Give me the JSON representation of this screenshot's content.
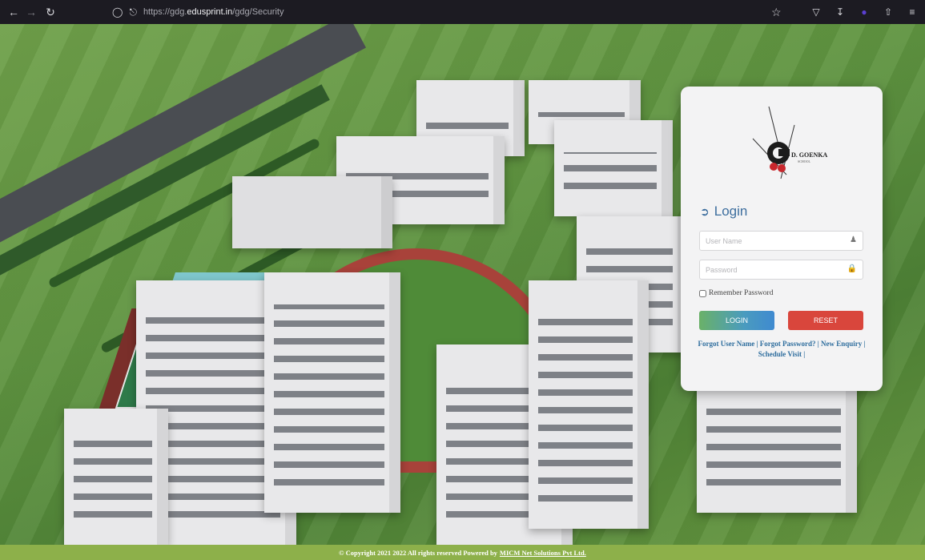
{
  "browser": {
    "url_prefix": "https://gdg.",
    "url_domain": "edusprint.in",
    "url_path": "/gdg/Security",
    "icons": [
      "back-arrow-icon",
      "forward-arrow-icon",
      "reload-icon",
      "shield-icon",
      "lock-icon",
      "star-icon",
      "pocket-icon",
      "download-icon",
      "extension-icon",
      "menu-icon"
    ]
  },
  "login": {
    "logo_text": "D. GOENKA",
    "logo_subtext": "SCHOOL",
    "title": "Login",
    "username_placeholder": "User Name",
    "password_placeholder": "Password",
    "remember_label": "Remember Password",
    "login_button": "LOGIN",
    "reset_button": "RESET",
    "links": {
      "forgot_user": "Forgot User Name",
      "forgot_password": "Forgot Password?",
      "new_enquiry": "New Enquiry",
      "schedule_visit": "Schedule Visit"
    },
    "colors": {
      "title": "#3d6e9e",
      "reset": "#d9463c",
      "login_start": "#6ab168",
      "login_end": "#3f8ad0"
    }
  },
  "footer": {
    "text": "© Copyright 2021 2022 All rights reserved Powered by",
    "link": "MICM Net Solutions Pvt Ltd.",
    "bg_color": "#8db04a"
  }
}
